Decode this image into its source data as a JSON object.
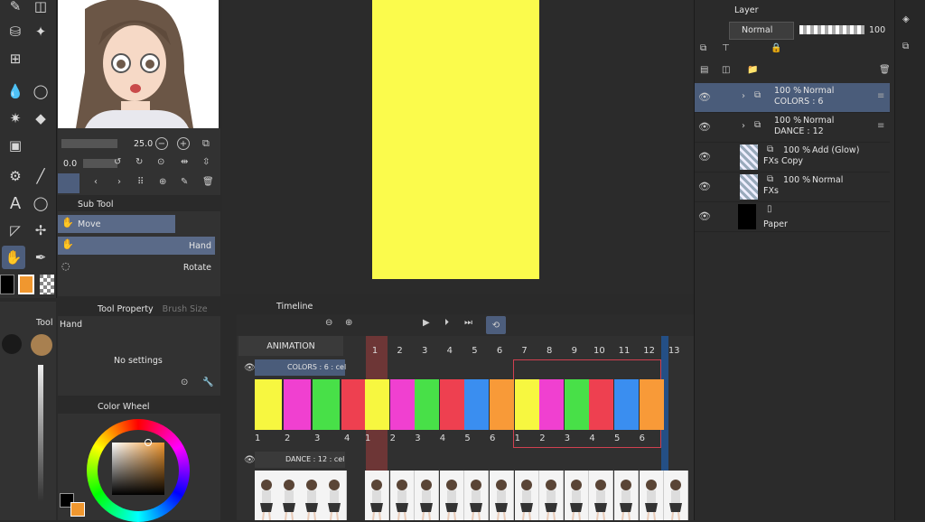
{
  "brush": {
    "size": "25.0",
    "opacity": "0.0"
  },
  "subtool": {
    "tab_label": "Sub Tool",
    "group_label": "Move",
    "items": [
      {
        "label": "Hand"
      },
      {
        "label": "Rotate"
      }
    ]
  },
  "tool_property": {
    "tab_label": "Tool Property",
    "tab2_label": "Brush Size",
    "tool_name": "Hand",
    "empty_text": "No settings",
    "side_label": "Tool"
  },
  "color_wheel": {
    "tab_label": "Color Wheel",
    "main_color": "#f0972f",
    "sub_color": "#000000"
  },
  "layer_panel": {
    "tab_label": "Layer",
    "blend_mode": "Normal",
    "opacity_value": "100",
    "layers": [
      {
        "opacity": "100 %",
        "mode": "Normal",
        "name": "COLORS : 6",
        "selected": true
      },
      {
        "opacity": "100 %",
        "mode": "Normal",
        "name": "DANCE : 12"
      },
      {
        "opacity": "100 %",
        "mode": "Add (Glow)",
        "name": "FXs Copy"
      },
      {
        "opacity": "100 %",
        "mode": "Normal",
        "name": "FXs"
      },
      {
        "opacity": "",
        "mode": "",
        "name": "Paper"
      }
    ]
  },
  "timeline": {
    "tab_label": "Timeline",
    "animation_label": "ANIMATION",
    "frame_numbers": [
      "1",
      "2",
      "3",
      "4",
      "5",
      "6",
      "7",
      "8",
      "9",
      "10",
      "11",
      "12",
      "13"
    ],
    "colors_track": "COLORS : 6 : cel",
    "dance_track": "DANCE : 12 : cel",
    "left_cel_numbers": [
      "1",
      "2",
      "3",
      "4"
    ],
    "cel_numbers": [
      "1",
      "2",
      "3",
      "4",
      "5",
      "6",
      "1",
      "2",
      "3",
      "4",
      "5",
      "6"
    ],
    "left_colors": [
      "#f7f740",
      "#f040d0",
      "#48e048",
      "#ee4050"
    ],
    "cel_colors": [
      "#f7f740",
      "#f040d0",
      "#48e048",
      "#ee4050",
      "#3a8ef0",
      "#f89a38",
      "#f7f740",
      "#f040d0",
      "#48e048",
      "#ee4050",
      "#3a8ef0",
      "#f89a38"
    ]
  }
}
